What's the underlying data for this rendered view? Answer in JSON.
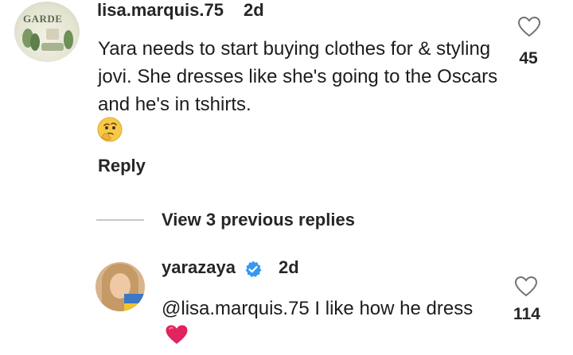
{
  "comment": {
    "username": "lisa.marquis.75",
    "time": "2d",
    "text": "Yara needs to start buying clothes for & styling jovi. She dresses like she's going to the Oscars and he's in tshirts.",
    "emoji": "thinking-face-emoji",
    "likes": "45",
    "reply_label": "Reply",
    "avatar_text": "GARDE"
  },
  "view_replies_label": "View 3 previous replies",
  "reply": {
    "username": "yarazaya",
    "verified": true,
    "time": "2d",
    "text": "@lisa.marquis.75 I like how he dress",
    "emoji": "red-heart-emoji",
    "likes": "114"
  },
  "colors": {
    "text": "#262626",
    "divider": "#c7c7c7",
    "verified_blue": "#3797f0",
    "heart_red": "#e0245e"
  }
}
